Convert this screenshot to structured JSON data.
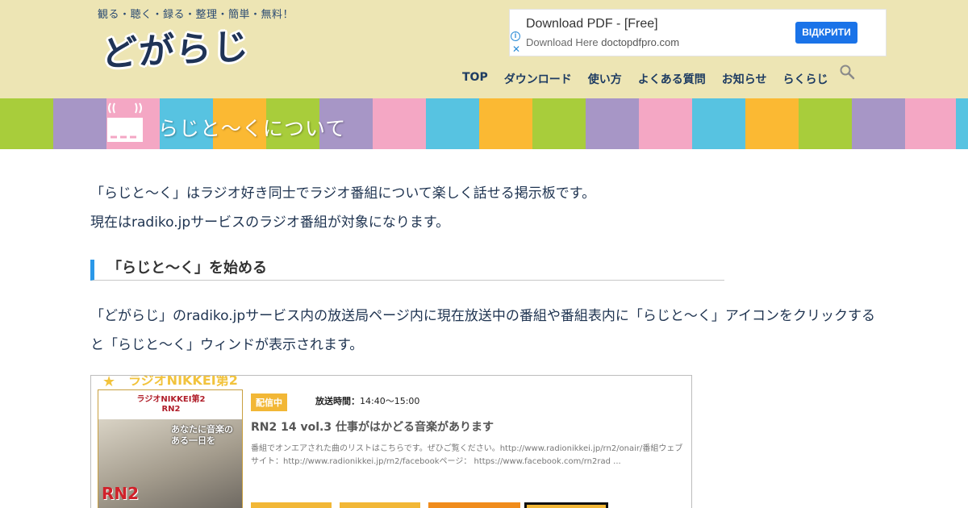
{
  "header": {
    "tagline": "観る・聴く・録る・整理・簡単・無料！",
    "logo": "どがらじ"
  },
  "ad": {
    "title": "Download PDF - [Free]",
    "sub_prefix": "Download Here",
    "sub_domain": "doctopdfpro.com",
    "button": "ВІДКРИТИ",
    "info_symbol": "i",
    "close_symbol": "✕"
  },
  "nav": {
    "items": [
      "TOP",
      "ダウンロード",
      "使い方",
      "よくある質問",
      "お知らせ",
      "らくらじ"
    ]
  },
  "banner": {
    "title": "らじと～くについて"
  },
  "content": {
    "intro_line1": "「らじと～く」はラジオ好き同士でラジオ番組について楽しく話せる掲示板です。",
    "intro_line2": "現在はradiko.jpサービスのラジオ番組が対象になります。",
    "section_heading": "「らじと～く」を始める",
    "section_text": "「どがらじ」のradiko.jpサービス内の放送局ページ内に現在放送中の番組や番組表内に「らじと～く」アイコンをクリックすると「らじと～く」ウィンドが表示されます。"
  },
  "screenshot": {
    "station": "ラジオNIKKEI第2",
    "thumb_logo_line1": "ラジオNIKKEI第2",
    "thumb_logo_line2": "RN2",
    "thumb_caption_line1": "あなたに音楽の",
    "thumb_caption_line2": "ある一日を",
    "thumb_mark": "RN2",
    "live_badge": "配信中",
    "airtime_label": "放送時間：",
    "airtime_value": "14:40〜15:00",
    "program_title": "RN2 14 vol.3 仕事がはかどる音楽があります",
    "program_desc": "番組でオンエアされた曲のリストはこちらです。ぜひご覧ください。http://www.radionikkei.jp/rn2/onair/番組ウェブサイト：http://www.radionikkei.jp/rn2/facebookページ： https://www.facebook.com/rn2rad ..."
  },
  "colors": {
    "header_bg": "#ede5b4",
    "accent_blue": "#2a98e8",
    "ad_button": "#1a73e8",
    "stripes": [
      "#a8cd3b",
      "#a796c6",
      "#f4a7c4",
      "#57c3e1",
      "#fbb933"
    ]
  }
}
